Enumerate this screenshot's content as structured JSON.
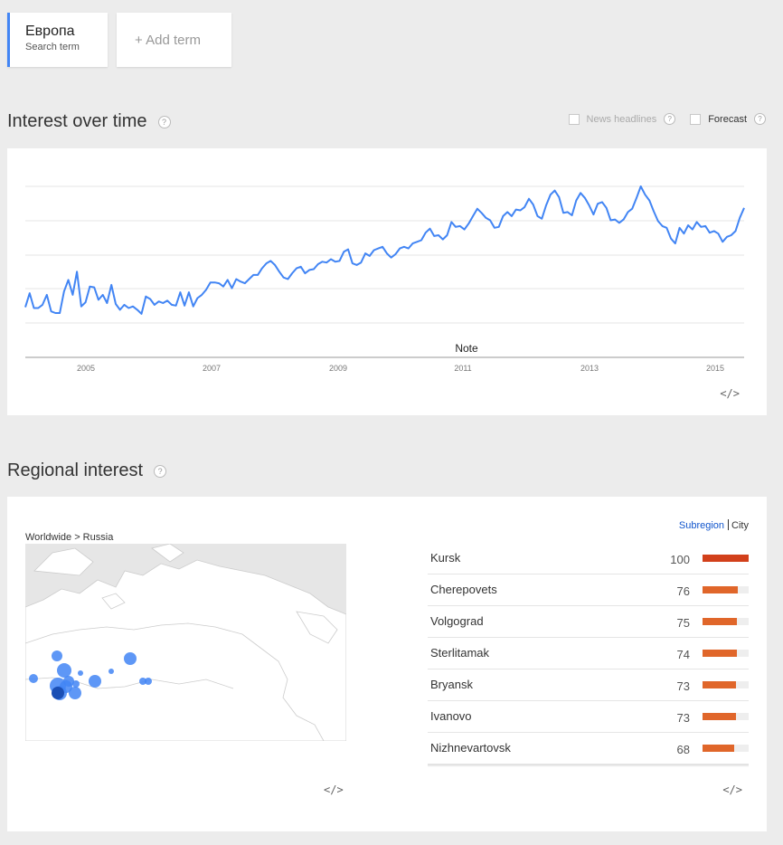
{
  "term": {
    "name": "Европа",
    "subtitle": "Search term"
  },
  "add_term": "+ Add term",
  "interest": {
    "title": "Interest over time",
    "help": "?",
    "news_headlines": "News headlines",
    "forecast": "Forecast",
    "note": "Note",
    "embed": "</>",
    "colors": {
      "line": "#4285f4"
    }
  },
  "chart_data": {
    "type": "line",
    "x_ticks": [
      "2005",
      "2007",
      "2009",
      "2011",
      "2013",
      "2015"
    ],
    "x_range": [
      "2004-01",
      "2015-06"
    ],
    "ylim": [
      0,
      100
    ],
    "grid": true,
    "series": [
      {
        "values": [
          19,
          36,
          18,
          18,
          22,
          34,
          14,
          12,
          12,
          38,
          52,
          34,
          62,
          20,
          25,
          44,
          43,
          28,
          34,
          24,
          46,
          23,
          16,
          22,
          18,
          20,
          16,
          11,
          32,
          29,
          22,
          26,
          24,
          27,
          22,
          21,
          37,
          21,
          37,
          20,
          30,
          34,
          40,
          49,
          49,
          48,
          44,
          52,
          42,
          53,
          50,
          48,
          53,
          58,
          58,
          66,
          72,
          75,
          70,
          62,
          55,
          53,
          60,
          66,
          68,
          60,
          64,
          65,
          71,
          74,
          73,
          77,
          74,
          75,
          86,
          89,
          72,
          70,
          73,
          84,
          81,
          88,
          90,
          92,
          84,
          79,
          83,
          90,
          92,
          90,
          96,
          98,
          100,
          109,
          114,
          105,
          106,
          101,
          106,
          122,
          116,
          117,
          113,
          120,
          129,
          138,
          133,
          127,
          124,
          115,
          116,
          129,
          134,
          129,
          137,
          136,
          140,
          150,
          143,
          129,
          126,
          142,
          155,
          160,
          152,
          133,
          134,
          130,
          148,
          157,
          151,
          142,
          131,
          144,
          146,
          139,
          124,
          125,
          121,
          125,
          134,
          138,
          151,
          165,
          155,
          148,
          135,
          123,
          117,
          115,
          102,
          96,
          115,
          108,
          118,
          113,
          122,
          116,
          117,
          109,
          111,
          108,
          98,
          104,
          106,
          111,
          127,
          139
        ],
        "color": "#4285f4"
      }
    ]
  },
  "regional": {
    "title": "Regional interest",
    "help": "?",
    "breadcrumb": "Worldwide > Russia",
    "toggle": {
      "subregion": "Subregion",
      "city": "City"
    },
    "embed": "</>",
    "colors": {
      "bar": "#e0662a",
      "bar_top": "#d2401b",
      "bubble": "#4285f4"
    },
    "rows": [
      {
        "name": "Kursk",
        "value": "100",
        "pct": 100
      },
      {
        "name": "Cherepovets",
        "value": "76",
        "pct": 76
      },
      {
        "name": "Volgograd",
        "value": "75",
        "pct": 75
      },
      {
        "name": "Sterlitamak",
        "value": "74",
        "pct": 74
      },
      {
        "name": "Bryansk",
        "value": "73",
        "pct": 73
      },
      {
        "name": "Ivanovo",
        "value": "73",
        "pct": 73
      },
      {
        "name": "Nizhnevartovsk",
        "value": "68",
        "pct": 68
      }
    ]
  }
}
